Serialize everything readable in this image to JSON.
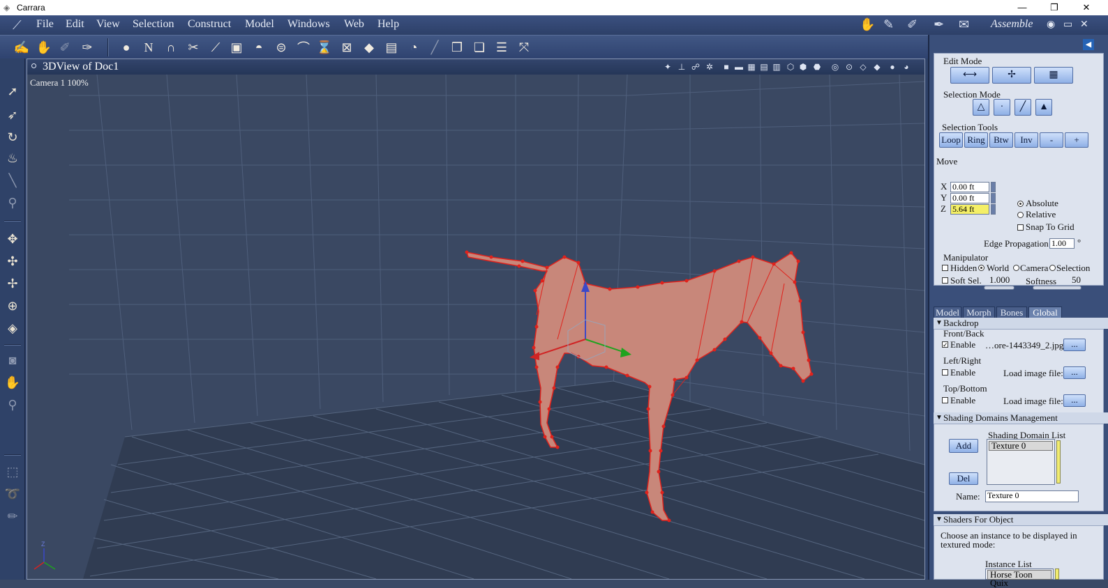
{
  "window": {
    "title": "Carrara",
    "controls": [
      "—",
      "❐",
      "✕"
    ]
  },
  "menu": [
    "File",
    "Edit",
    "View",
    "Selection",
    "Construct",
    "Model",
    "Windows",
    "Web",
    "Help"
  ],
  "room": {
    "current": "Assemble"
  },
  "viewport": {
    "title": "3DView of Doc1",
    "camera_label": "Camera 1 100%"
  },
  "edit_mode": {
    "header": "Edit Mode"
  },
  "selection_mode": {
    "header": "Selection Mode"
  },
  "selection_tools": {
    "header": "Selection Tools",
    "buttons": [
      "Loop",
      "Ring",
      "Btw",
      "Inv",
      "-",
      "+"
    ]
  },
  "move": {
    "header": "Move",
    "x_label": "X",
    "x_value": "0.00 ft",
    "y_label": "Y",
    "y_value": "0.00 ft",
    "z_label": "Z",
    "z_value": "5.64 ft",
    "absolute": "Absolute",
    "relative": "Relative",
    "snap": "Snap To Grid",
    "edge_prop_label": "Edge Propagation",
    "edge_prop_value": "1.00",
    "edge_prop_unit": "°"
  },
  "manipulator": {
    "header": "Manipulator",
    "hidden": "Hidden",
    "world": "World",
    "camera": "Camera",
    "selection": "Selection",
    "soft_sel": "Soft Sel.",
    "soft_sel_value": "1.000",
    "softness": "Softness",
    "softness_value": "50"
  },
  "tabs": [
    "Model",
    "Morph",
    "Bones",
    "Global"
  ],
  "backdrop": {
    "section": "Backdrop",
    "front_back": "Front/Back",
    "front_enable": "Enable",
    "front_file": "…ore-1443349_2.jpg",
    "left_right": "Left/Right",
    "left_enable": "Enable",
    "left_load": "Load image file:",
    "top_bottom": "Top/Bottom",
    "top_enable": "Enable",
    "top_load": "Load image file:",
    "browse": "..."
  },
  "shading_domains": {
    "section": "Shading Domains Management",
    "list_header": "Shading Domain List",
    "add": "Add",
    "del": "Del",
    "items": [
      "Texture 0"
    ],
    "name_label": "Name:",
    "name_value": "Texture 0"
  },
  "shaders": {
    "section": "Shaders For Object",
    "desc": "Choose an instance to be displayed in textured mode:",
    "list_header": "Instance List",
    "items": [
      "Horse Toon Quix"
    ]
  },
  "colors": {
    "horse": "#c8877a",
    "horse_edges": "#e0221c",
    "bg": "#3a4862"
  }
}
